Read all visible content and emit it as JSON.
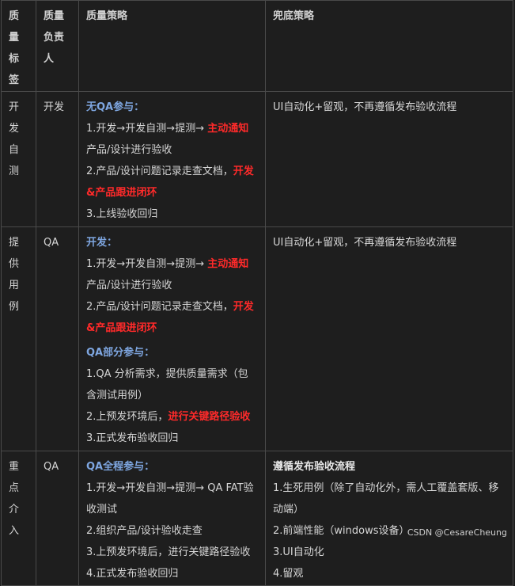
{
  "headers": {
    "tag": "质量标签",
    "owner": "质量负责人",
    "strategy": "质量策略",
    "fallback": "兜底策略"
  },
  "rows": [
    {
      "tag": "开发自测",
      "owner": "开发",
      "strategy": {
        "sections": [
          {
            "title": "无QA参与：",
            "items": [
              {
                "pre": "1.开发→开发自测→提测→ ",
                "red": "主动通知",
                "post": "产品/设计进行验收"
              },
              {
                "pre": "2.产品/设计问题记录走查文档，",
                "red": "开发&产品跟进闭环",
                "post": ""
              },
              {
                "pre": "3.上线验收回归",
                "red": "",
                "post": ""
              }
            ]
          }
        ]
      },
      "fallback": {
        "title": "",
        "items": [
          "UI自动化+留观，不再遵循发布验收流程"
        ]
      }
    },
    {
      "tag": "提供用例",
      "owner": "QA",
      "strategy": {
        "sections": [
          {
            "title": "开发：",
            "items": [
              {
                "pre": "1.开发→开发自测→提测→ ",
                "red": "主动通知",
                "post": "产品/设计进行验收"
              },
              {
                "pre": "2.产品/设计问题记录走查文档，",
                "red": "开发&产品跟进闭环",
                "post": ""
              }
            ]
          },
          {
            "title": "QA部分参与：",
            "items": [
              {
                "pre": "1.QA 分析需求，提供质量需求（包含测试用例）",
                "red": "",
                "post": ""
              },
              {
                "pre": "2.上预发环境后，",
                "red": "进行关键路径验收",
                "post": ""
              },
              {
                "pre": "3.正式发布验收回归",
                "red": "",
                "post": ""
              }
            ]
          }
        ]
      },
      "fallback": {
        "title": "",
        "items": [
          "UI自动化+留观，不再遵循发布验收流程"
        ]
      }
    },
    {
      "tag": "重点介入",
      "owner": "QA",
      "strategy": {
        "sections": [
          {
            "title": "QA全程参与：",
            "items": [
              {
                "pre": "1.开发→开发自测→提测→ QA FAT验收测试",
                "red": "",
                "post": ""
              },
              {
                "pre": "2.组织产品/设计验收走查",
                "red": "",
                "post": ""
              },
              {
                "pre": "3.上预发环境后，进行关键路径验收",
                "red": "",
                "post": ""
              },
              {
                "pre": "4.正式发布验收回归",
                "red": "",
                "post": ""
              }
            ]
          }
        ]
      },
      "fallback": {
        "title": "遵循发布验收流程",
        "items": [
          "1.生死用例（除了自动化外，需人工覆盖套版、移动端）",
          "2.前端性能（windows设备）",
          "3.UI自动化",
          "4.留观"
        ]
      }
    }
  ],
  "watermark": "CSDN @CesareCheung"
}
